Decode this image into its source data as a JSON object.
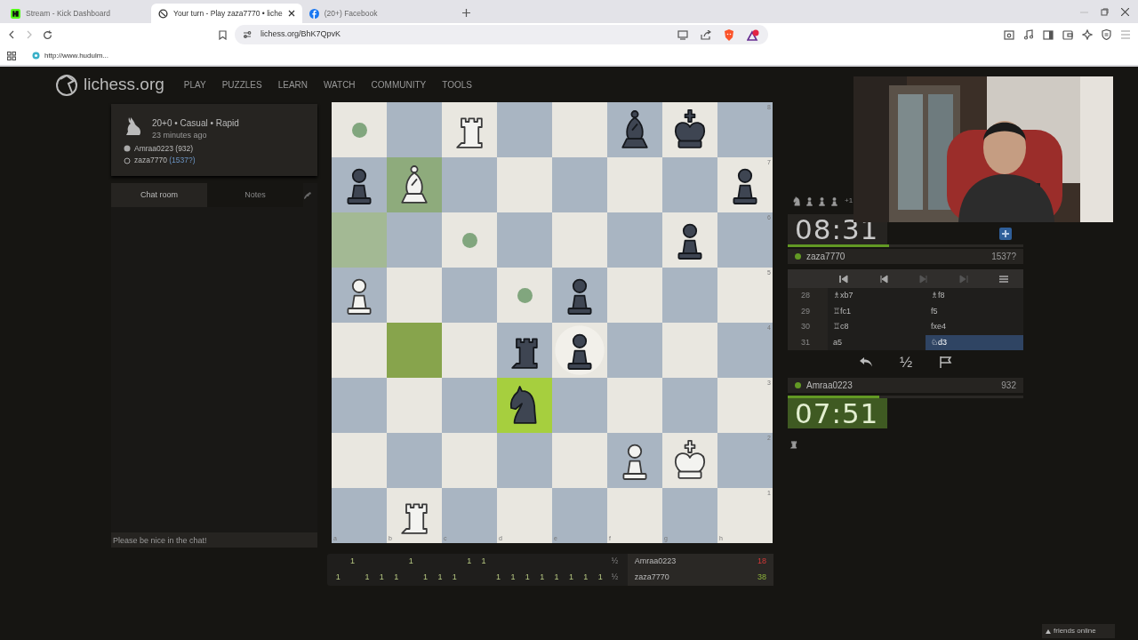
{
  "browser": {
    "tabs": [
      {
        "title": "Stream - Kick Dashboard",
        "kind": "kick",
        "selected": false
      },
      {
        "title": "Your turn - Play zaza7770 • liche",
        "kind": "lichess",
        "selected": true
      },
      {
        "title": "(20+) Facebook",
        "kind": "facebook",
        "selected": false
      }
    ],
    "address": "lichess.org/BhK7QpvK",
    "bookmarks": [
      "http://www.hudulm..."
    ]
  },
  "site": {
    "logo": "lichess.org",
    "nav": [
      "PLAY",
      "PUZZLES",
      "LEARN",
      "WATCH",
      "COMMUNITY",
      "TOOLS"
    ]
  },
  "game_info": {
    "setup": "20+0 • Casual • Rapid",
    "time_ago": "23 minutes ago",
    "players": [
      {
        "name": "Amraa0223",
        "rating": "(932)",
        "white": true
      },
      {
        "name": "zaza7770",
        "rating": "(1537?)",
        "white": false
      }
    ]
  },
  "chat": {
    "tabs": [
      {
        "label": "Chat room",
        "selected": true
      },
      {
        "label": "Notes",
        "selected": false
      }
    ],
    "placeholder": "Please be nice in the chat!"
  },
  "board": {
    "rank_labels": [
      "8",
      "7",
      "6",
      "5",
      "4",
      "3",
      "2",
      "1"
    ],
    "file_labels": [
      "a",
      "b",
      "c",
      "d",
      "e",
      "f",
      "g",
      "h"
    ],
    "ranks": [
      [
        {
          "kind": "empty",
          "selected": false,
          "move_dot": true
        },
        {
          "kind": "empty",
          "selected": false
        },
        {
          "kind": "rook",
          "white": true,
          "selected": false
        },
        {
          "kind": "empty",
          "selected": false
        },
        {
          "kind": "empty",
          "selected": false
        },
        {
          "kind": "bishop",
          "white": false,
          "selected": false
        },
        {
          "kind": "king",
          "white": false,
          "selected": false
        },
        {
          "kind": "empty",
          "selected": false
        }
      ],
      [
        {
          "kind": "pawn",
          "white": false,
          "selected": false
        },
        {
          "kind": "bishop",
          "white": true,
          "selected": true
        },
        {
          "kind": "empty",
          "selected": false
        },
        {
          "kind": "empty",
          "selected": false
        },
        {
          "kind": "empty",
          "selected": false
        },
        {
          "kind": "empty",
          "selected": false
        },
        {
          "kind": "empty",
          "selected": false
        },
        {
          "kind": "pawn",
          "white": false,
          "selected": false
        }
      ],
      [
        {
          "kind": "empty",
          "selected": false,
          "hover": true
        },
        {
          "kind": "empty",
          "selected": false
        },
        {
          "kind": "empty",
          "selected": false,
          "move_dot": true
        },
        {
          "kind": "empty",
          "selected": false
        },
        {
          "kind": "empty",
          "selected": false
        },
        {
          "kind": "empty",
          "selected": false
        },
        {
          "kind": "pawn",
          "white": false,
          "selected": false
        },
        {
          "kind": "empty",
          "selected": false
        }
      ],
      [
        {
          "kind": "pawn",
          "white": true,
          "selected": false
        },
        {
          "kind": "empty",
          "selected": false
        },
        {
          "kind": "empty",
          "selected": false
        },
        {
          "kind": "empty",
          "selected": false,
          "move_dot": true
        },
        {
          "kind": "pawn",
          "white": false,
          "selected": false
        },
        {
          "kind": "empty",
          "selected": false
        },
        {
          "kind": "empty",
          "selected": false
        },
        {
          "kind": "empty",
          "selected": false
        }
      ],
      [
        {
          "kind": "empty",
          "selected": false
        },
        {
          "kind": "empty",
          "selected": false,
          "last_move_from": true
        },
        {
          "kind": "empty",
          "selected": false
        },
        {
          "kind": "rook",
          "white": false,
          "selected": false
        },
        {
          "kind": "pawn",
          "white": false,
          "selected": false,
          "capture": true
        },
        {
          "kind": "empty",
          "selected": false
        },
        {
          "kind": "empty",
          "selected": false
        },
        {
          "kind": "empty",
          "selected": false
        }
      ],
      [
        {
          "kind": "empty",
          "selected": false
        },
        {
          "kind": "empty",
          "selected": false
        },
        {
          "kind": "empty",
          "selected": false
        },
        {
          "kind": "knight",
          "white": false,
          "selected": false,
          "last_move_to": true
        },
        {
          "kind": "empty",
          "selected": false
        },
        {
          "kind": "empty",
          "selected": false
        },
        {
          "kind": "empty",
          "selected": false
        },
        {
          "kind": "empty",
          "selected": false
        }
      ],
      [
        {
          "kind": "empty",
          "selected": false
        },
        {
          "kind": "empty",
          "selected": false
        },
        {
          "kind": "empty",
          "selected": false
        },
        {
          "kind": "empty",
          "selected": false
        },
        {
          "kind": "empty",
          "selected": false
        },
        {
          "kind": "pawn",
          "white": true,
          "selected": false
        },
        {
          "kind": "king",
          "white": true,
          "selected": false
        },
        {
          "kind": "empty",
          "selected": false
        }
      ],
      [
        {
          "kind": "empty",
          "selected": false
        },
        {
          "kind": "rook",
          "white": true,
          "selected": false
        },
        {
          "kind": "empty",
          "selected": false
        },
        {
          "kind": "empty",
          "selected": false
        },
        {
          "kind": "empty",
          "selected": false
        },
        {
          "kind": "empty",
          "selected": false
        },
        {
          "kind": "empty",
          "selected": false
        },
        {
          "kind": "empty",
          "selected": false
        }
      ]
    ]
  },
  "opponent": {
    "captured": [
      {
        "kind": "knight"
      },
      {
        "kind": "pawn"
      },
      {
        "kind": "pawn"
      },
      {
        "kind": "pawn"
      }
    ],
    "advantage": "+1",
    "clock": "08:31",
    "running": false,
    "level": 0.43,
    "name": "zaza7770",
    "rating": "1537?",
    "online": true
  },
  "controls": [
    {
      "kind": "first",
      "disabled": false
    },
    {
      "kind": "prev",
      "disabled": false
    },
    {
      "kind": "next",
      "disabled": true
    },
    {
      "kind": "last",
      "disabled": true
    },
    {
      "kind": "menu",
      "disabled": false
    }
  ],
  "moves": [
    {
      "number": "28",
      "white": {
        "text": "♗xb7",
        "selected": false
      },
      "black": {
        "text": "♗f8",
        "selected": false
      }
    },
    {
      "number": "29",
      "white": {
        "text": "♖fc1",
        "selected": false
      },
      "black": {
        "text": "f5",
        "selected": false
      }
    },
    {
      "number": "30",
      "white": {
        "text": "♖c8",
        "selected": false
      },
      "black": {
        "text": "fxe4",
        "selected": false
      }
    },
    {
      "number": "31",
      "white": {
        "text": "a5",
        "selected": false
      },
      "black": {
        "text": "♘d3",
        "selected": true
      }
    }
  ],
  "actions": [
    {
      "kind": "takeback"
    },
    {
      "kind": "draw",
      "label": "½"
    },
    {
      "kind": "resign"
    }
  ],
  "player": {
    "name": "Amraa0223",
    "rating": "932",
    "online": true,
    "clock": "07:51",
    "running": true,
    "level": 0.39,
    "captured": [
      {
        "kind": "rook"
      }
    ]
  },
  "crosstable": {
    "rows": [
      {
        "results": [
          {
            "kind": "none"
          },
          {
            "kind": "win",
            "text": "1"
          },
          {
            "kind": "none"
          },
          {
            "kind": "none"
          },
          {
            "kind": "none"
          },
          {
            "kind": "win",
            "text": "1"
          },
          {
            "kind": "none"
          },
          {
            "kind": "none"
          },
          {
            "kind": "none"
          },
          {
            "kind": "win",
            "text": "1"
          },
          {
            "kind": "win",
            "text": "1"
          },
          {
            "kind": "none"
          },
          {
            "kind": "none"
          },
          {
            "kind": "none"
          },
          {
            "kind": "none"
          },
          {
            "kind": "none"
          },
          {
            "kind": "none"
          },
          {
            "kind": "none"
          },
          {
            "kind": "none"
          }
        ],
        "current": "½",
        "name": "Amraa0223",
        "total": "18",
        "leading": false
      },
      {
        "results": [
          {
            "kind": "win",
            "text": "1"
          },
          {
            "kind": "none"
          },
          {
            "kind": "win",
            "text": "1"
          },
          {
            "kind": "win",
            "text": "1"
          },
          {
            "kind": "win",
            "text": "1"
          },
          {
            "kind": "none"
          },
          {
            "kind": "win",
            "text": "1"
          },
          {
            "kind": "win",
            "text": "1"
          },
          {
            "kind": "win",
            "text": "1"
          },
          {
            "kind": "none"
          },
          {
            "kind": "none"
          },
          {
            "kind": "win",
            "text": "1"
          },
          {
            "kind": "win",
            "text": "1"
          },
          {
            "kind": "win",
            "text": "1"
          },
          {
            "kind": "win",
            "text": "1"
          },
          {
            "kind": "win",
            "text": "1"
          },
          {
            "kind": "win",
            "text": "1"
          },
          {
            "kind": "win",
            "text": "1"
          },
          {
            "kind": "win",
            "text": "1"
          }
        ],
        "current": "½",
        "name": "zaza7770",
        "total": "38",
        "leading": true
      }
    ]
  },
  "friends": {
    "label": "friends online"
  }
}
